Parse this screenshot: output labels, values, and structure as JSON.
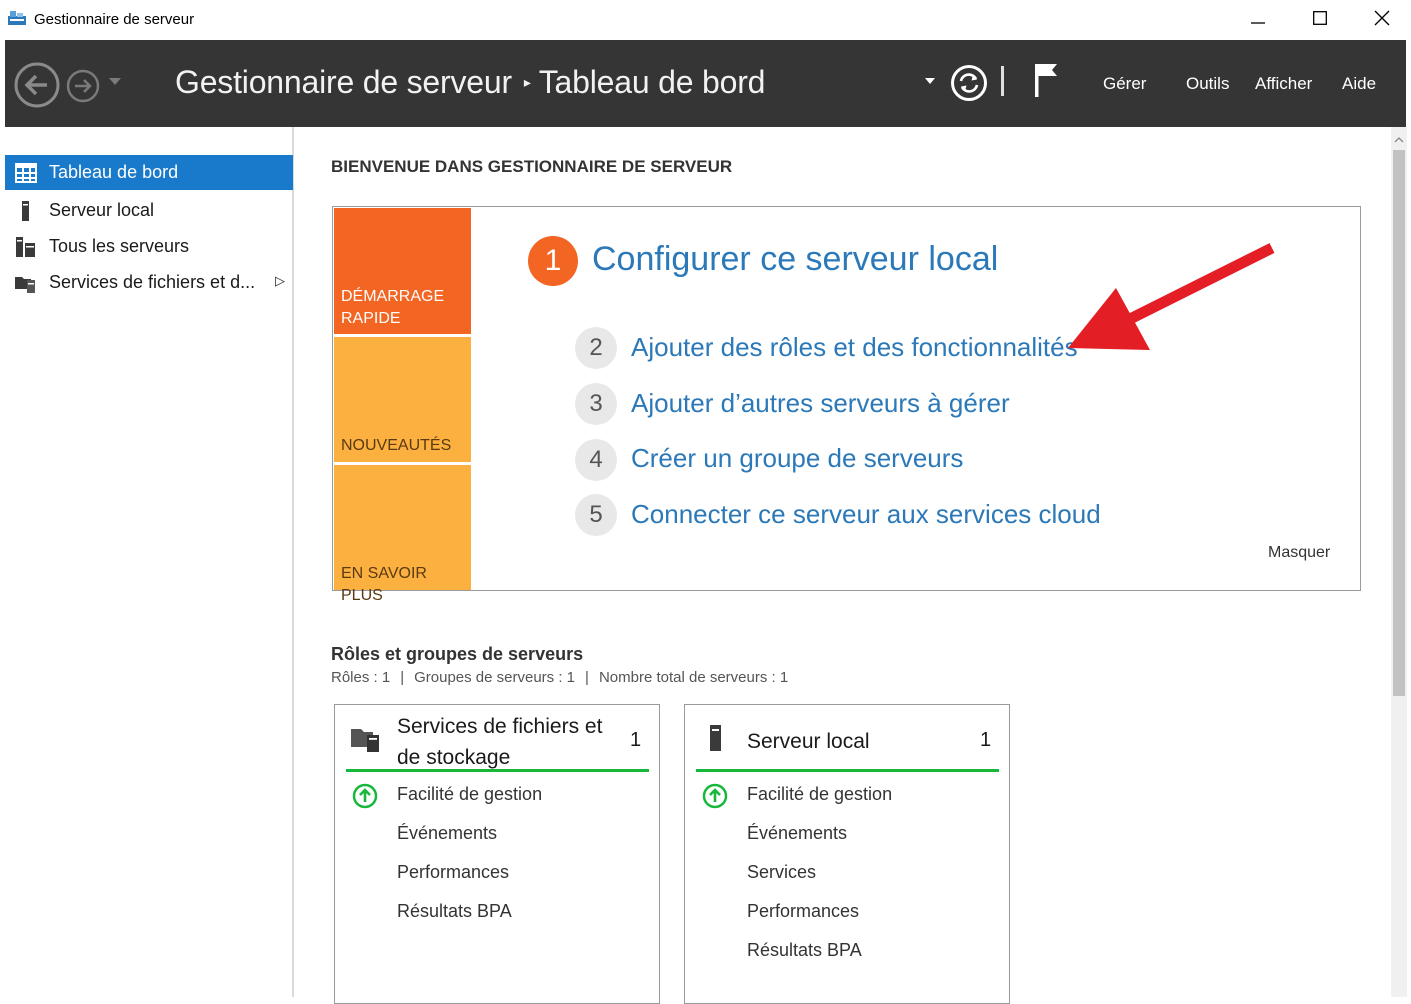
{
  "window": {
    "title": "Gestionnaire de serveur",
    "icon": "server-manager-icon",
    "controls": {
      "minimize": "minimize-icon",
      "maximize": "maximize-icon",
      "close": "close-icon"
    }
  },
  "header": {
    "breadcrumb_root": "Gestionnaire de serveur",
    "breadcrumb_separator": "▸",
    "breadcrumb_current": "Tableau de bord",
    "menu": [
      "Gérer",
      "Outils",
      "Afficher",
      "Aide"
    ],
    "background": "#353535"
  },
  "sidebar": {
    "items": [
      {
        "label": "Tableau de bord",
        "icon": "dashboard-grid-icon",
        "active": true
      },
      {
        "label": "Serveur local",
        "icon": "server-tower-icon"
      },
      {
        "label": "Tous les serveurs",
        "icon": "servers-icon"
      },
      {
        "label": "Services de fichiers et d...",
        "icon": "file-services-icon",
        "expand": "▷"
      }
    ],
    "active_color": "#1979ca"
  },
  "welcome": {
    "title": "BIENVENUE DANS GESTIONNAIRE DE SERVEUR",
    "tiles": [
      "DÉMARRAGE RAPIDE",
      "NOUVEAUTÉS",
      "EN SAVOIR PLUS"
    ],
    "tile_colors": [
      "#f26522",
      "#fbb040",
      "#fbb040"
    ],
    "steps": [
      {
        "num": "1",
        "label": "Configurer ce serveur local"
      },
      {
        "num": "2",
        "label": "Ajouter des rôles et des fonctionnalités"
      },
      {
        "num": "3",
        "label": "Ajouter d’autres serveurs à gérer"
      },
      {
        "num": "4",
        "label": "Créer un groupe de serveurs"
      },
      {
        "num": "5",
        "label": "Connecter ce serveur aux services cloud"
      }
    ],
    "hide": "Masquer",
    "link_color": "#2b79b8"
  },
  "roles": {
    "title": "Rôles et groupes de serveurs",
    "summary": [
      "Rôles : 1",
      "Groupes de serveurs : 1",
      "Nombre total de serveurs : 1"
    ],
    "separator": "|",
    "cards": [
      {
        "title": "Services de fichiers et de stockage",
        "count": "1",
        "icon": "file-services-icon",
        "rows": [
          "Facilité de gestion",
          "Événements",
          "Performances",
          "Résultats BPA"
        ]
      },
      {
        "title": "Serveur local",
        "count": "1",
        "icon": "server-tower-icon",
        "rows": [
          "Facilité de gestion",
          "Événements",
          "Services",
          "Performances",
          "Résultats BPA"
        ]
      }
    ],
    "status_color": "#17b83c"
  }
}
